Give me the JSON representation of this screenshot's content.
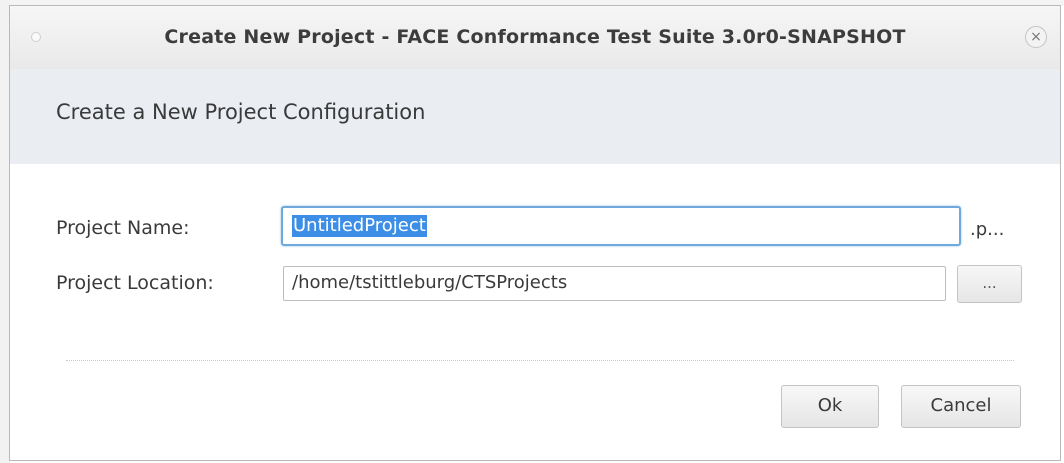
{
  "window": {
    "title": "Create New Project - FACE Conformance Test Suite 3.0r0-SNAPSHOT",
    "close_glyph": "×"
  },
  "banner": {
    "heading": "Create a New Project Configuration"
  },
  "form": {
    "project_name": {
      "label": "Project Name:",
      "value": "UntitledProject",
      "extension": ".p..."
    },
    "project_location": {
      "label": "Project Location:",
      "value": "/home/tstittleburg/CTSProjects",
      "browse_label": "..."
    }
  },
  "buttons": {
    "ok": "Ok",
    "cancel": "Cancel"
  },
  "colors": {
    "selection": "#3d8ee6",
    "focus_border": "#6fa9dc",
    "banner_bg": "#eaeef3"
  }
}
